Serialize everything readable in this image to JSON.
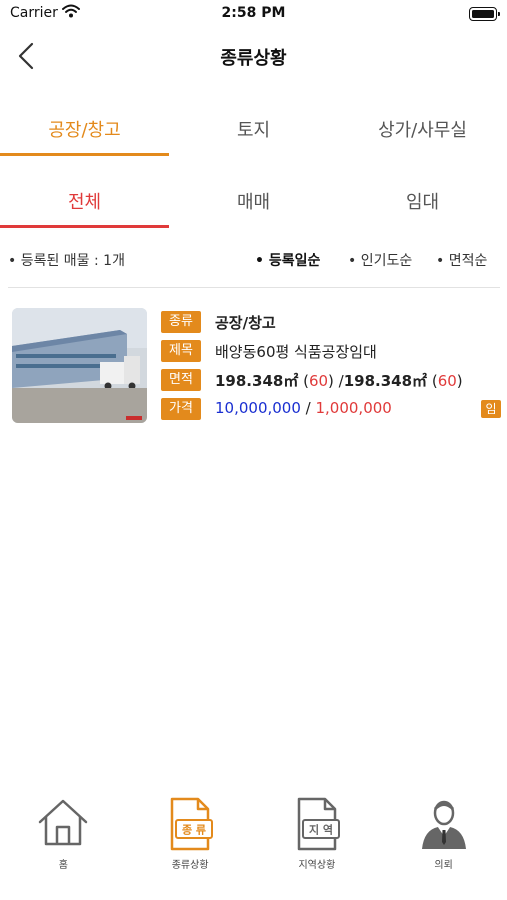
{
  "status_bar": {
    "carrier": "Carrier",
    "time": "2:58 PM"
  },
  "nav": {
    "title": "종류상황"
  },
  "category_tabs": [
    {
      "label": "공장/창고",
      "active": true
    },
    {
      "label": "토지",
      "active": false
    },
    {
      "label": "상가/사무실",
      "active": false
    }
  ],
  "deal_tabs": [
    {
      "label": "전체",
      "active": true
    },
    {
      "label": "매매",
      "active": false
    },
    {
      "label": "임대",
      "active": false
    }
  ],
  "filter": {
    "count_text": "• 등록된 매물 : 1개",
    "sorts": [
      "• 등록일순",
      "• 인기도순",
      "• 면적순"
    ],
    "active_sort": 0
  },
  "listing": {
    "labels": {
      "type": "종류",
      "title": "제목",
      "area": "면적",
      "price": "가격"
    },
    "type_value": "공장/창고",
    "title_value": "배양동60평 식품공장임대",
    "area": {
      "main1": "198.348㎡",
      "paren1_open": " (",
      "paren1_val": "60",
      "paren1_close": ")",
      "sep": " /",
      "main2": "198.348㎡",
      "paren2_open": " (",
      "paren2_val": "60",
      "paren2_close": ")"
    },
    "price": {
      "deposit": "10,000,000",
      "sep": " / ",
      "monthly": "1,000,000"
    },
    "badge": "임"
  },
  "bottom_bar": {
    "items": [
      {
        "label": "홈",
        "icon": "home-icon",
        "active": false
      },
      {
        "label": "종류상황",
        "icon": "type-doc-icon",
        "icon_text": "종 류",
        "active": true
      },
      {
        "label": "지역상황",
        "icon": "region-doc-icon",
        "icon_text": "지 역",
        "active": false
      },
      {
        "label": "의뢰",
        "icon": "person-icon",
        "active": false
      }
    ]
  },
  "colors": {
    "accent": "#e38a1c",
    "active_tab": "#e03a3a",
    "price_blue": "#1a2fd1"
  }
}
